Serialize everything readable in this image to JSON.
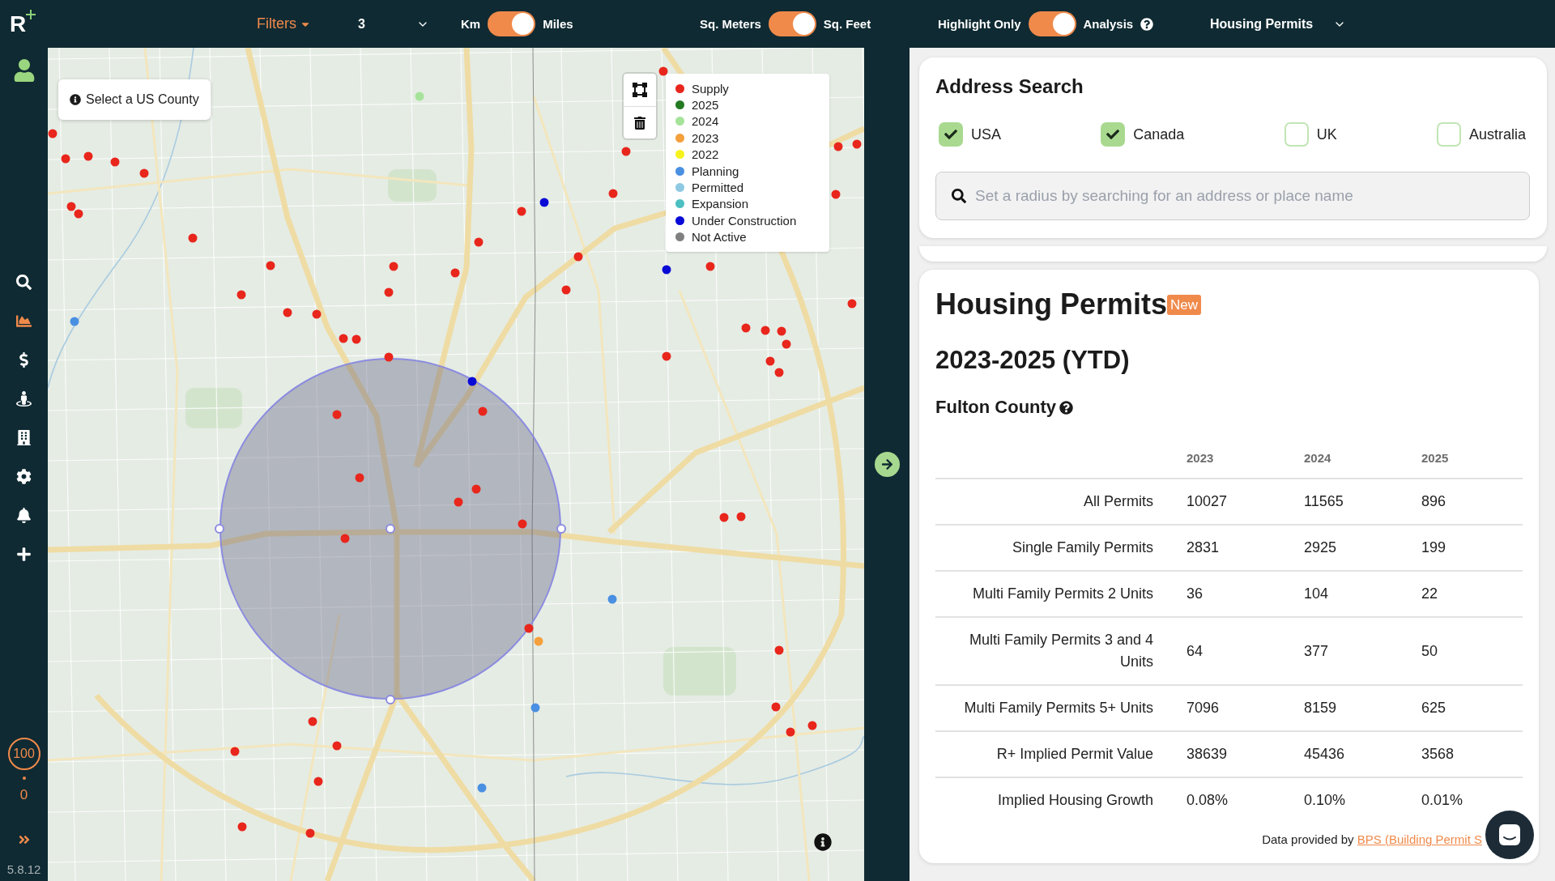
{
  "top_bar": {
    "logo": "R",
    "filters": "Filters",
    "radius_select": "3",
    "toggles": [
      {
        "left": "Km",
        "right": "Miles",
        "on": true,
        "help": false
      },
      {
        "left": "Sq. Meters",
        "right": "Sq. Feet",
        "on": true,
        "help": false
      },
      {
        "left": "Highlight Only",
        "right": "Analysis",
        "on": true,
        "help": true
      }
    ],
    "layer_select": "Housing Permits"
  },
  "sidebar": {
    "nav_items": [
      {
        "selected": false
      },
      {
        "selected": true
      },
      {
        "selected": false
      },
      {
        "selected": false
      },
      {
        "selected": false
      },
      {
        "selected": false
      },
      {
        "selected": false
      },
      {
        "selected": false
      }
    ],
    "score": "100",
    "score_sub": "0",
    "version": "5.8.12"
  },
  "map": {
    "county_button": "Select a US County",
    "legend": [
      {
        "label": "Supply",
        "color": "#e8261c"
      },
      {
        "label": "2025",
        "color": "#237a23"
      },
      {
        "label": "2024",
        "color": "#a6e39a"
      },
      {
        "label": "2023",
        "color": "#f4a03c"
      },
      {
        "label": "2022",
        "color": "#f7f21e"
      },
      {
        "label": "Planning",
        "color": "#4a90e2"
      },
      {
        "label": "Permitted",
        "color": "#8ec9e3"
      },
      {
        "label": "Expansion",
        "color": "#4bbfc1"
      },
      {
        "label": "Under Construction",
        "color": "#0a0ad6"
      },
      {
        "label": "Not Active",
        "color": "#808080"
      }
    ]
  },
  "address_search": {
    "title": "Address Search",
    "countries": [
      {
        "label": "USA",
        "checked": true
      },
      {
        "label": "Canada",
        "checked": true
      },
      {
        "label": "UK",
        "checked": false
      },
      {
        "label": "Australia",
        "checked": false
      }
    ],
    "search": {
      "placeholder": "Set a radius by searching for an address or place name"
    }
  },
  "housing_permits": {
    "title": "Housing Permits",
    "badge": "New",
    "period": "2023-2025 (YTD)",
    "area": "Fulton County",
    "table": {
      "columns": [
        "2023",
        "2024",
        "2025"
      ],
      "rows": [
        {
          "label": "All Permits",
          "values": [
            "10027",
            "11565",
            "896"
          ]
        },
        {
          "label": "Single Family Permits",
          "values": [
            "2831",
            "2925",
            "199"
          ]
        },
        {
          "label": "Multi Family Permits 2 Units",
          "values": [
            "36",
            "104",
            "22"
          ]
        },
        {
          "label": "Multi Family Permits 3 and 4 Units",
          "values": [
            "64",
            "377",
            "50"
          ]
        },
        {
          "label": "Multi Family Permits 5+ Units",
          "values": [
            "7096",
            "8159",
            "625"
          ]
        },
        {
          "label": "R+ Implied Permit Value",
          "values": [
            "38639",
            "45436",
            "3568"
          ]
        },
        {
          "label": "Implied Housing Growth",
          "values": [
            "0.08%",
            "0.10%",
            "0.01%"
          ]
        }
      ]
    },
    "footer": {
      "text": "Data provided by",
      "link": "BPS (Building Permit S"
    }
  }
}
